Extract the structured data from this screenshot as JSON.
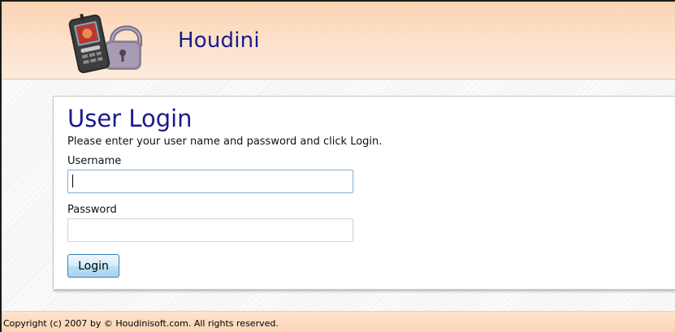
{
  "header": {
    "site_title": "Houdini",
    "logo_icon": "phone-and-padlock-icon"
  },
  "login": {
    "title": "User Login",
    "instruction": "Please enter your user name and password and click Login.",
    "username_label": "Username",
    "username_value": "",
    "password_label": "Password",
    "password_value": "",
    "login_button_label": "Login"
  },
  "footer": {
    "copyright": "Copyright (c) 2007 by © Houdinisoft.com. All rights reserved."
  },
  "colors": {
    "title_blue": "#1a1a8c",
    "header_peach": "#fbd3b2",
    "button_blue": "#a7d2ef"
  }
}
